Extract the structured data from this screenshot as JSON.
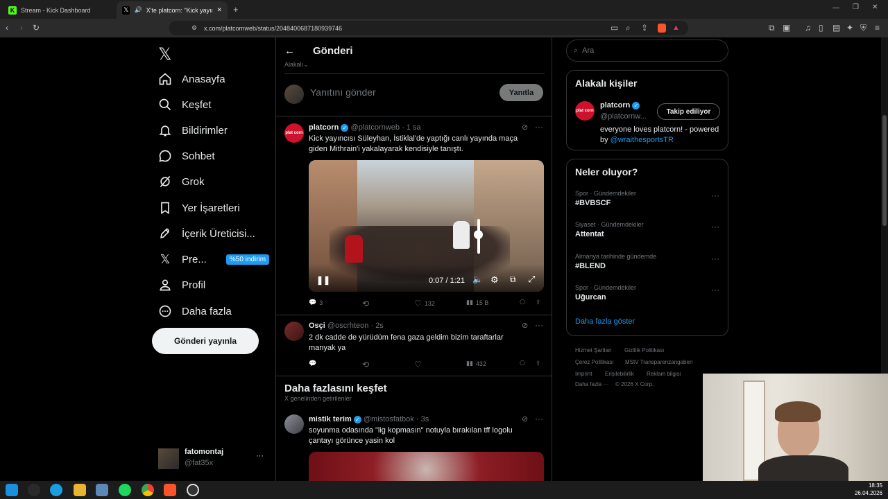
{
  "browser": {
    "tabs": [
      {
        "title": "Stream - Kick Dashboard"
      },
      {
        "title": "X'te platcorn: \"Kick yayıncısı S"
      }
    ],
    "url": "x.com/platcornweb/status/2048400687180939746"
  },
  "sidebar": {
    "items": [
      {
        "label": "Anasayfa"
      },
      {
        "label": "Keşfet"
      },
      {
        "label": "Bildirimler"
      },
      {
        "label": "Sohbet"
      },
      {
        "label": "Grok"
      },
      {
        "label": "Yer İşaretleri"
      },
      {
        "label": "İçerik Üreticisi..."
      },
      {
        "label": "Pre...",
        "badge": "%50 indirim"
      },
      {
        "label": "Profil"
      },
      {
        "label": "Daha fazla"
      }
    ],
    "post_button": "Gönderi yayınla",
    "account": {
      "name": "fatomontaj",
      "handle": "@fat35x",
      "more": "···"
    }
  },
  "header": {
    "title": "Gönderi",
    "sort_label": "Alakalı"
  },
  "reply_box": {
    "placeholder": "Yanıtını gönder",
    "button": "Yanıtla"
  },
  "tweets": [
    {
      "name": "platcorn",
      "handle": "@platcornweb",
      "time": "· 1 sa",
      "text": "Kick yayıncısı Süleyhan, İstiklal'de yaptığı canlı yayında maça giden Mithrain'i yakalayarak kendisiyle tanıştı.",
      "video_time": "0:07 / 1:21",
      "video_volume": 0.55,
      "stats": {
        "replies": "3",
        "reposts": "",
        "likes": "132",
        "views": "15 B"
      }
    },
    {
      "name": "Osçi",
      "handle": "@oscrhteon",
      "time": "· 2s",
      "text": "2 dk cadde de yürüdüm fena gaza geldim bizim taraftarlar manyak ya",
      "stats": {
        "replies": "",
        "reposts": "",
        "likes": "",
        "views": "432"
      }
    }
  ],
  "discover": {
    "title": "Daha fazlasını keşfet",
    "subtitle": "X genelinden getirilenler"
  },
  "tweet3": {
    "name": "mistik terim",
    "handle": "@mistosfatbok",
    "time": "· 3s",
    "text": "soyunma odasında \"lig kopmasın\" notuyla bırakılan tff logolu çantayı görünce yasin kol"
  },
  "search": {
    "placeholder": "Ara"
  },
  "related": {
    "title": "Alakalı kişiler",
    "name": "platcorn",
    "handle": "@platcornw...",
    "button": "Takip ediliyor",
    "bio": "everyone loves platcorn! - powered by",
    "bio_link": "@wraithesportsTR"
  },
  "trends": {
    "title": "Neler oluyor?",
    "items": [
      {
        "category": "Spor · Gündemdekiler",
        "title": "#BVBSCF"
      },
      {
        "category": "Siyaset · Gündemdekiler",
        "title": "Attentat"
      },
      {
        "category": "Almanya tarihinde gündemde",
        "title": "#BLEND"
      },
      {
        "category": "Spor · Gündemdekiler",
        "title": "Uğurcan"
      }
    ],
    "more": "Daha fazla göster"
  },
  "footer": {
    "links": [
      "Hizmet Şartları",
      "Gizlilik Politikası",
      "Çerez Politikası",
      "MStV Transparenzangaben",
      "Imprint",
      "Erişilebilirlik",
      "Reklam bilgisi",
      "Daha fazla ···",
      "© 2026 X Corp."
    ]
  },
  "taskbar": {
    "time": "18:35",
    "date": "26.04.2026"
  },
  "colors": {
    "accent": "#1d9bf0",
    "background": "#000000",
    "border": "#2f3336"
  }
}
